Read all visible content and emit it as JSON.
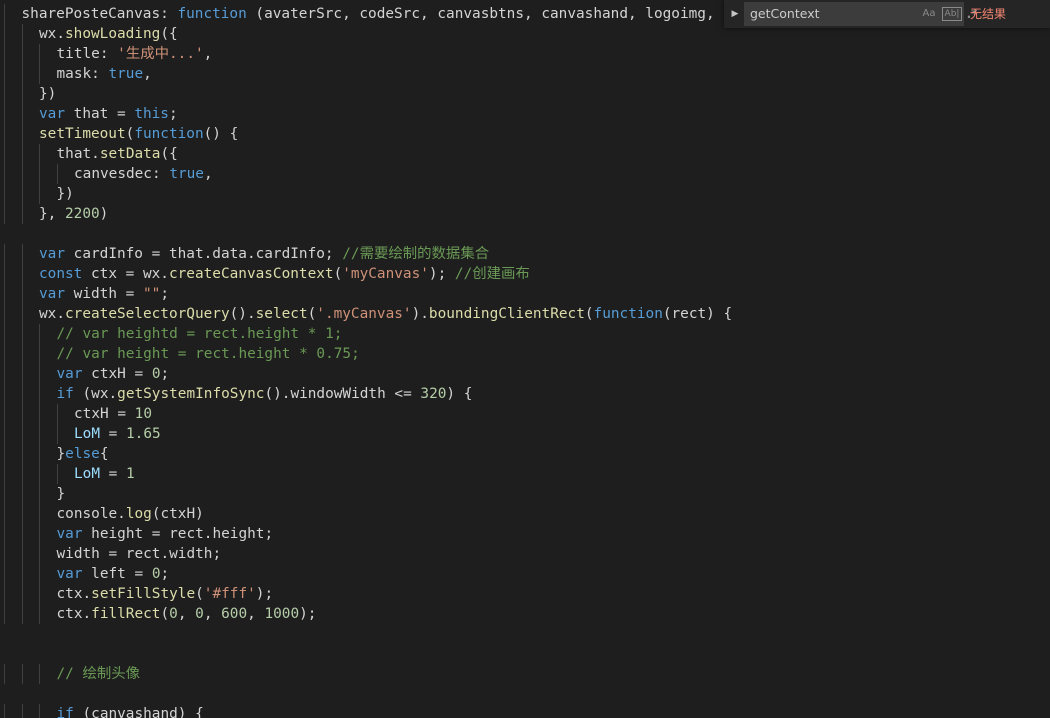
{
  "editor": {
    "lines": [
      {
        "indent": 1,
        "tokens": [
          [
            "sharePosteCanvas: ",
            "default"
          ],
          [
            "function",
            "kw"
          ],
          [
            " (avaterSrc, codeSrc, canvasbtns, canvashand, logoimg,",
            "default"
          ]
        ]
      },
      {
        "indent": 2,
        "tokens": [
          [
            "wx.",
            "default"
          ],
          [
            "showLoading",
            "fn"
          ],
          [
            "({",
            "default"
          ]
        ]
      },
      {
        "indent": 3,
        "tokens": [
          [
            "title: ",
            "default"
          ],
          [
            "'生成中...'",
            "str"
          ],
          [
            ",",
            "default"
          ]
        ]
      },
      {
        "indent": 3,
        "tokens": [
          [
            "mask: ",
            "default"
          ],
          [
            "true",
            "kw"
          ],
          [
            ",",
            "default"
          ]
        ]
      },
      {
        "indent": 2,
        "tokens": [
          [
            "})",
            "default"
          ]
        ]
      },
      {
        "indent": 2,
        "tokens": [
          [
            "var",
            "kw"
          ],
          [
            " that = ",
            "default"
          ],
          [
            "this",
            "kw"
          ],
          [
            ";",
            "default"
          ]
        ]
      },
      {
        "indent": 2,
        "tokens": [
          [
            "setTimeout",
            "fn"
          ],
          [
            "(",
            "default"
          ],
          [
            "function",
            "kw"
          ],
          [
            "() {",
            "default"
          ]
        ]
      },
      {
        "indent": 3,
        "tokens": [
          [
            "that.",
            "default"
          ],
          [
            "setData",
            "fn"
          ],
          [
            "({",
            "default"
          ]
        ]
      },
      {
        "indent": 4,
        "tokens": [
          [
            "canvesdec: ",
            "default"
          ],
          [
            "true",
            "kw"
          ],
          [
            ",",
            "default"
          ]
        ]
      },
      {
        "indent": 3,
        "tokens": [
          [
            "})",
            "default"
          ]
        ]
      },
      {
        "indent": 2,
        "tokens": [
          [
            "}, ",
            "default"
          ],
          [
            "2200",
            "num"
          ],
          [
            ")",
            "default"
          ]
        ]
      },
      {
        "indent": 0,
        "tokens": []
      },
      {
        "indent": 2,
        "tokens": [
          [
            "var",
            "kw"
          ],
          [
            " cardInfo = that.data.cardInfo; ",
            "default"
          ],
          [
            "//需要绘制的数据集合",
            "comment"
          ]
        ]
      },
      {
        "indent": 2,
        "tokens": [
          [
            "const",
            "kw"
          ],
          [
            " ctx = wx.",
            "default"
          ],
          [
            "createCanvasContext",
            "fn"
          ],
          [
            "(",
            "default"
          ],
          [
            "'myCanvas'",
            "str"
          ],
          [
            "); ",
            "default"
          ],
          [
            "//创建画布",
            "comment"
          ]
        ]
      },
      {
        "indent": 2,
        "tokens": [
          [
            "var",
            "kw"
          ],
          [
            " width = ",
            "default"
          ],
          [
            "\"\"",
            "str"
          ],
          [
            ";",
            "default"
          ]
        ]
      },
      {
        "indent": 2,
        "tokens": [
          [
            "wx.",
            "default"
          ],
          [
            "createSelectorQuery",
            "fn"
          ],
          [
            "().",
            "default"
          ],
          [
            "select",
            "fn"
          ],
          [
            "(",
            "default"
          ],
          [
            "'.myCanvas'",
            "str"
          ],
          [
            ").",
            "default"
          ],
          [
            "boundingClientRect",
            "fn"
          ],
          [
            "(",
            "default"
          ],
          [
            "function",
            "kw"
          ],
          [
            "(rect) {",
            "default"
          ]
        ]
      },
      {
        "indent": 3,
        "tokens": [
          [
            "// var heightd = rect.height * 1;",
            "comment"
          ]
        ]
      },
      {
        "indent": 3,
        "tokens": [
          [
            "// var height = rect.height * 0.75;",
            "comment"
          ]
        ]
      },
      {
        "indent": 3,
        "tokens": [
          [
            "var",
            "kw"
          ],
          [
            " ctxH = ",
            "default"
          ],
          [
            "0",
            "num"
          ],
          [
            ";",
            "default"
          ]
        ]
      },
      {
        "indent": 3,
        "tokens": [
          [
            "if",
            "kw"
          ],
          [
            " (wx.",
            "default"
          ],
          [
            "getSystemInfoSync",
            "fn"
          ],
          [
            "().windowWidth <= ",
            "default"
          ],
          [
            "320",
            "num"
          ],
          [
            ") {",
            "default"
          ]
        ]
      },
      {
        "indent": 4,
        "tokens": [
          [
            "ctxH = ",
            "default"
          ],
          [
            "10",
            "num"
          ]
        ]
      },
      {
        "indent": 4,
        "tokens": [
          [
            "LoM",
            "var"
          ],
          [
            " = ",
            "default"
          ],
          [
            "1.65",
            "num"
          ]
        ]
      },
      {
        "indent": 3,
        "tokens": [
          [
            "}",
            "default"
          ],
          [
            "else",
            "kw"
          ],
          [
            "{",
            "default"
          ]
        ]
      },
      {
        "indent": 4,
        "tokens": [
          [
            "LoM",
            "var"
          ],
          [
            " = ",
            "default"
          ],
          [
            "1",
            "num"
          ]
        ]
      },
      {
        "indent": 3,
        "tokens": [
          [
            "}",
            "default"
          ]
        ]
      },
      {
        "indent": 3,
        "tokens": [
          [
            "console.",
            "default"
          ],
          [
            "log",
            "fn"
          ],
          [
            "(ctxH)",
            "default"
          ]
        ]
      },
      {
        "indent": 3,
        "tokens": [
          [
            "var",
            "kw"
          ],
          [
            " height = rect.height;",
            "default"
          ]
        ]
      },
      {
        "indent": 3,
        "tokens": [
          [
            "width = rect.width;",
            "default"
          ]
        ]
      },
      {
        "indent": 3,
        "tokens": [
          [
            "var",
            "kw"
          ],
          [
            " left = ",
            "default"
          ],
          [
            "0",
            "num"
          ],
          [
            ";",
            "default"
          ]
        ]
      },
      {
        "indent": 3,
        "tokens": [
          [
            "ctx.",
            "default"
          ],
          [
            "setFillStyle",
            "fn"
          ],
          [
            "(",
            "default"
          ],
          [
            "'#fff'",
            "str"
          ],
          [
            ");",
            "default"
          ]
        ]
      },
      {
        "indent": 3,
        "tokens": [
          [
            "ctx.",
            "default"
          ],
          [
            "fillRect",
            "fn"
          ],
          [
            "(",
            "default"
          ],
          [
            "0",
            "num"
          ],
          [
            ", ",
            "default"
          ],
          [
            "0",
            "num"
          ],
          [
            ", ",
            "default"
          ],
          [
            "600",
            "num"
          ],
          [
            ", ",
            "default"
          ],
          [
            "1000",
            "num"
          ],
          [
            ");",
            "default"
          ]
        ]
      },
      {
        "indent": 0,
        "tokens": []
      },
      {
        "indent": 0,
        "tokens": []
      },
      {
        "indent": 3,
        "tokens": [
          [
            "// 绘制头像",
            "comment"
          ]
        ]
      },
      {
        "indent": 0,
        "tokens": []
      },
      {
        "indent": 3,
        "tokens": [
          [
            "if",
            "kw"
          ],
          [
            " (canvashand) {",
            "default"
          ]
        ]
      }
    ]
  },
  "find_widget": {
    "toggle_icon": "chevron-right-icon",
    "search_value": "getContext",
    "match_case_label": "Aa",
    "whole_word_label": "Ab|",
    "regex_label": ".*",
    "result_text": "无结果"
  },
  "colors": {
    "background": "#1e1e1e",
    "keyword": "#569cd6",
    "string": "#ce9178",
    "number": "#b5cea8",
    "function": "#dcdcaa",
    "variable": "#9cdcfe",
    "comment": "#6a9955",
    "no_result": "#f48771"
  }
}
